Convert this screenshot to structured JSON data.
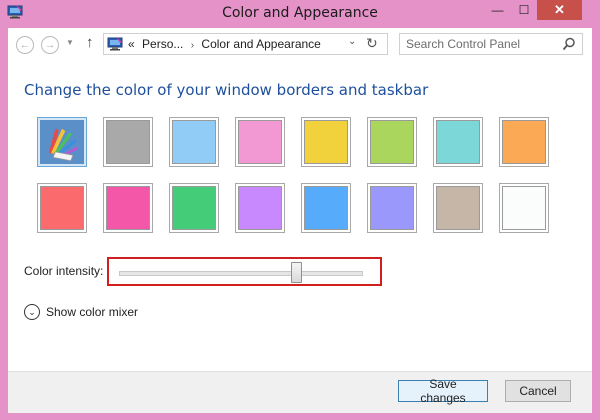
{
  "window": {
    "title": "Color and Appearance",
    "controls": {
      "minimize": "—",
      "maximize": "☐",
      "close": "✕"
    }
  },
  "navbar": {
    "back_icon": "←",
    "forward_icon": "→",
    "up_icon": "↑",
    "breadcrumb": {
      "prefix": "«",
      "parent": "Perso...",
      "separator": "›",
      "current": "Color and Appearance"
    },
    "refresh_icon": "↻",
    "search_placeholder": "Search Control Panel"
  },
  "main": {
    "heading": "Change the color of your window borders and taskbar",
    "swatches_row1": [
      {
        "name": "automatic",
        "color": "multicolor",
        "selected": true
      },
      {
        "name": "gray",
        "color": "#a9a9a9"
      },
      {
        "name": "sky-blue",
        "color": "#91ccf6"
      },
      {
        "name": "pink",
        "color": "#f298d2"
      },
      {
        "name": "yellow",
        "color": "#f2d23c"
      },
      {
        "name": "lime",
        "color": "#abd65d"
      },
      {
        "name": "teal",
        "color": "#7cd8d8"
      },
      {
        "name": "orange",
        "color": "#fba955"
      }
    ],
    "swatches_row2": [
      {
        "name": "red",
        "color": "#fb6a6c"
      },
      {
        "name": "magenta",
        "color": "#f457a8"
      },
      {
        "name": "green",
        "color": "#44cc78"
      },
      {
        "name": "violet",
        "color": "#c889ff"
      },
      {
        "name": "blue",
        "color": "#56abfb"
      },
      {
        "name": "periwinkle",
        "color": "#9b98fc"
      },
      {
        "name": "taupe",
        "color": "#c6b6a8"
      },
      {
        "name": "white",
        "color": "#fbfcfc"
      }
    ],
    "intensity_label": "Color intensity:",
    "intensity_value": 0.73,
    "mixer_icon": "⌄",
    "mixer_label": "Show color mixer"
  },
  "footer": {
    "save_label": "Save changes",
    "cancel_label": "Cancel"
  }
}
